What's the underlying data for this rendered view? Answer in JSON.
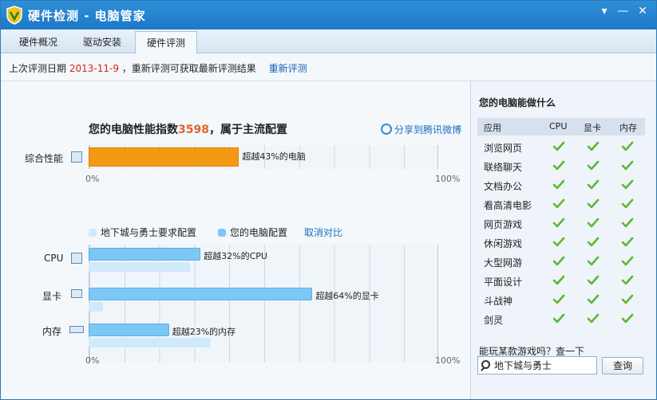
{
  "window": {
    "title": "硬件检测 - 电脑管家",
    "controls": [
      "▾",
      "—",
      "✕"
    ]
  },
  "tabs": [
    {
      "label": "硬件概况",
      "active": false
    },
    {
      "label": "驱动安装",
      "active": false
    },
    {
      "label": "硬件评测",
      "active": true
    }
  ],
  "info": {
    "prefix": "上次评测日期",
    "date": "2013-11-9",
    "suffix": "，重新评测可获取最新评测结果",
    "retest_link": "重新评测"
  },
  "perf": {
    "title_prefix": "您的电脑性能指数",
    "score": "3598",
    "title_suffix": "，属于主流配置",
    "share_label": "分享到腾讯微博",
    "overall_label": "综合性能",
    "overall_percent": 43,
    "overall_text": "超越43%的电脑",
    "axis_min": "0%",
    "axis_max": "100%"
  },
  "legend": {
    "required": "地下城与勇士要求配置",
    "yours": "您的电脑配置",
    "cancel": "取消对比"
  },
  "components": [
    {
      "label": "CPU",
      "percent": 32,
      "required_percent": 29,
      "text": "超越32%的CPU"
    },
    {
      "label": "显卡",
      "percent": 64,
      "required_percent": 4,
      "text": "超越64%的显卡"
    },
    {
      "label": "内存",
      "percent": 23,
      "required_percent": 35,
      "text": "超越23%的内存"
    }
  ],
  "axis2": {
    "min": "0%",
    "max": "100%"
  },
  "capabilities": {
    "title": "您的电脑能做什么",
    "headers": [
      "应用",
      "CPU",
      "显卡",
      "内存"
    ],
    "rows": [
      {
        "name": "浏览网页",
        "cpu": true,
        "gpu": true,
        "mem": true
      },
      {
        "name": "联络聊天",
        "cpu": true,
        "gpu": true,
        "mem": true
      },
      {
        "name": "文档办公",
        "cpu": true,
        "gpu": true,
        "mem": true
      },
      {
        "name": "看高清电影",
        "cpu": true,
        "gpu": true,
        "mem": true
      },
      {
        "name": "网页游戏",
        "cpu": true,
        "gpu": true,
        "mem": true
      },
      {
        "name": "休闲游戏",
        "cpu": true,
        "gpu": true,
        "mem": true
      },
      {
        "name": "大型网游",
        "cpu": true,
        "gpu": true,
        "mem": true
      },
      {
        "name": "平面设计",
        "cpu": true,
        "gpu": true,
        "mem": true
      },
      {
        "name": "斗战神",
        "cpu": true,
        "gpu": true,
        "mem": true
      },
      {
        "name": "剑灵",
        "cpu": true,
        "gpu": true,
        "mem": true
      }
    ]
  },
  "query": {
    "label": "能玩某款游戏吗？查一下",
    "value": "地下城与勇士",
    "button": "查询"
  },
  "colors": {
    "orange": "#f39a12",
    "blue": "#7cc7f4",
    "light_blue": "#cfeafb",
    "check_green": "#5cb832",
    "score_red": "#e0632a",
    "date_red": "#d0261d"
  }
}
